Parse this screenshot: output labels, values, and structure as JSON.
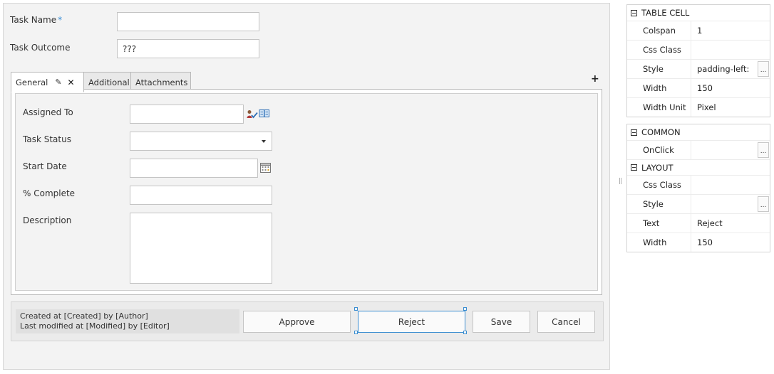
{
  "form": {
    "task_name": {
      "label": "Task Name",
      "required_mark": "*",
      "value": ""
    },
    "task_outcome": {
      "label": "Task Outcome",
      "value": "???"
    }
  },
  "tabs": [
    {
      "label": "General",
      "active": true
    },
    {
      "label": "Additional",
      "active": false
    },
    {
      "label": "Attachments",
      "active": false
    }
  ],
  "tab_controls": {
    "edit_icon": "pencil-icon",
    "close_icon": "close-icon",
    "add_icon": "plus-icon",
    "add_symbol": "+",
    "close_symbol": "✕",
    "edit_symbol": "✎"
  },
  "general": {
    "assigned_to": {
      "label": "Assigned To",
      "value": ""
    },
    "task_status": {
      "label": "Task Status",
      "value": ""
    },
    "start_date": {
      "label": "Start Date",
      "value": ""
    },
    "percent_complete": {
      "label": "% Complete",
      "value": ""
    },
    "description": {
      "label": "Description",
      "value": ""
    }
  },
  "footer": {
    "created_text": "Created at [Created] by [Author]",
    "modified_text": "Last modified at [Modified] by [Editor]",
    "buttons": {
      "approve": "Approve",
      "reject": "Reject",
      "save": "Save",
      "cancel": "Cancel"
    }
  },
  "properties": {
    "table_cell": {
      "header": "TABLE CELL",
      "rows": [
        {
          "name": "Colspan",
          "value": "1",
          "has_button": false
        },
        {
          "name": "Css Class",
          "value": "",
          "has_button": false
        },
        {
          "name": "Style",
          "value": "padding-left:",
          "has_button": true
        },
        {
          "name": "Width",
          "value": "150",
          "has_button": false
        },
        {
          "name": "Width Unit",
          "value": "Pixel",
          "has_button": false
        }
      ]
    },
    "common": {
      "header": "COMMON",
      "rows": [
        {
          "name": "OnClick",
          "value": "",
          "has_button": true
        }
      ]
    },
    "layout": {
      "header": "LAYOUT",
      "rows": [
        {
          "name": "Css Class",
          "value": "",
          "has_button": false
        },
        {
          "name": "Style",
          "value": "",
          "has_button": true
        },
        {
          "name": "Text",
          "value": "Reject",
          "has_button": false
        },
        {
          "name": "Width",
          "value": "150",
          "has_button": false
        }
      ]
    },
    "ellipsis": "...",
    "splitter": "||"
  },
  "colors": {
    "selection": "#3d8fd1",
    "required": "#3a8fd6"
  }
}
